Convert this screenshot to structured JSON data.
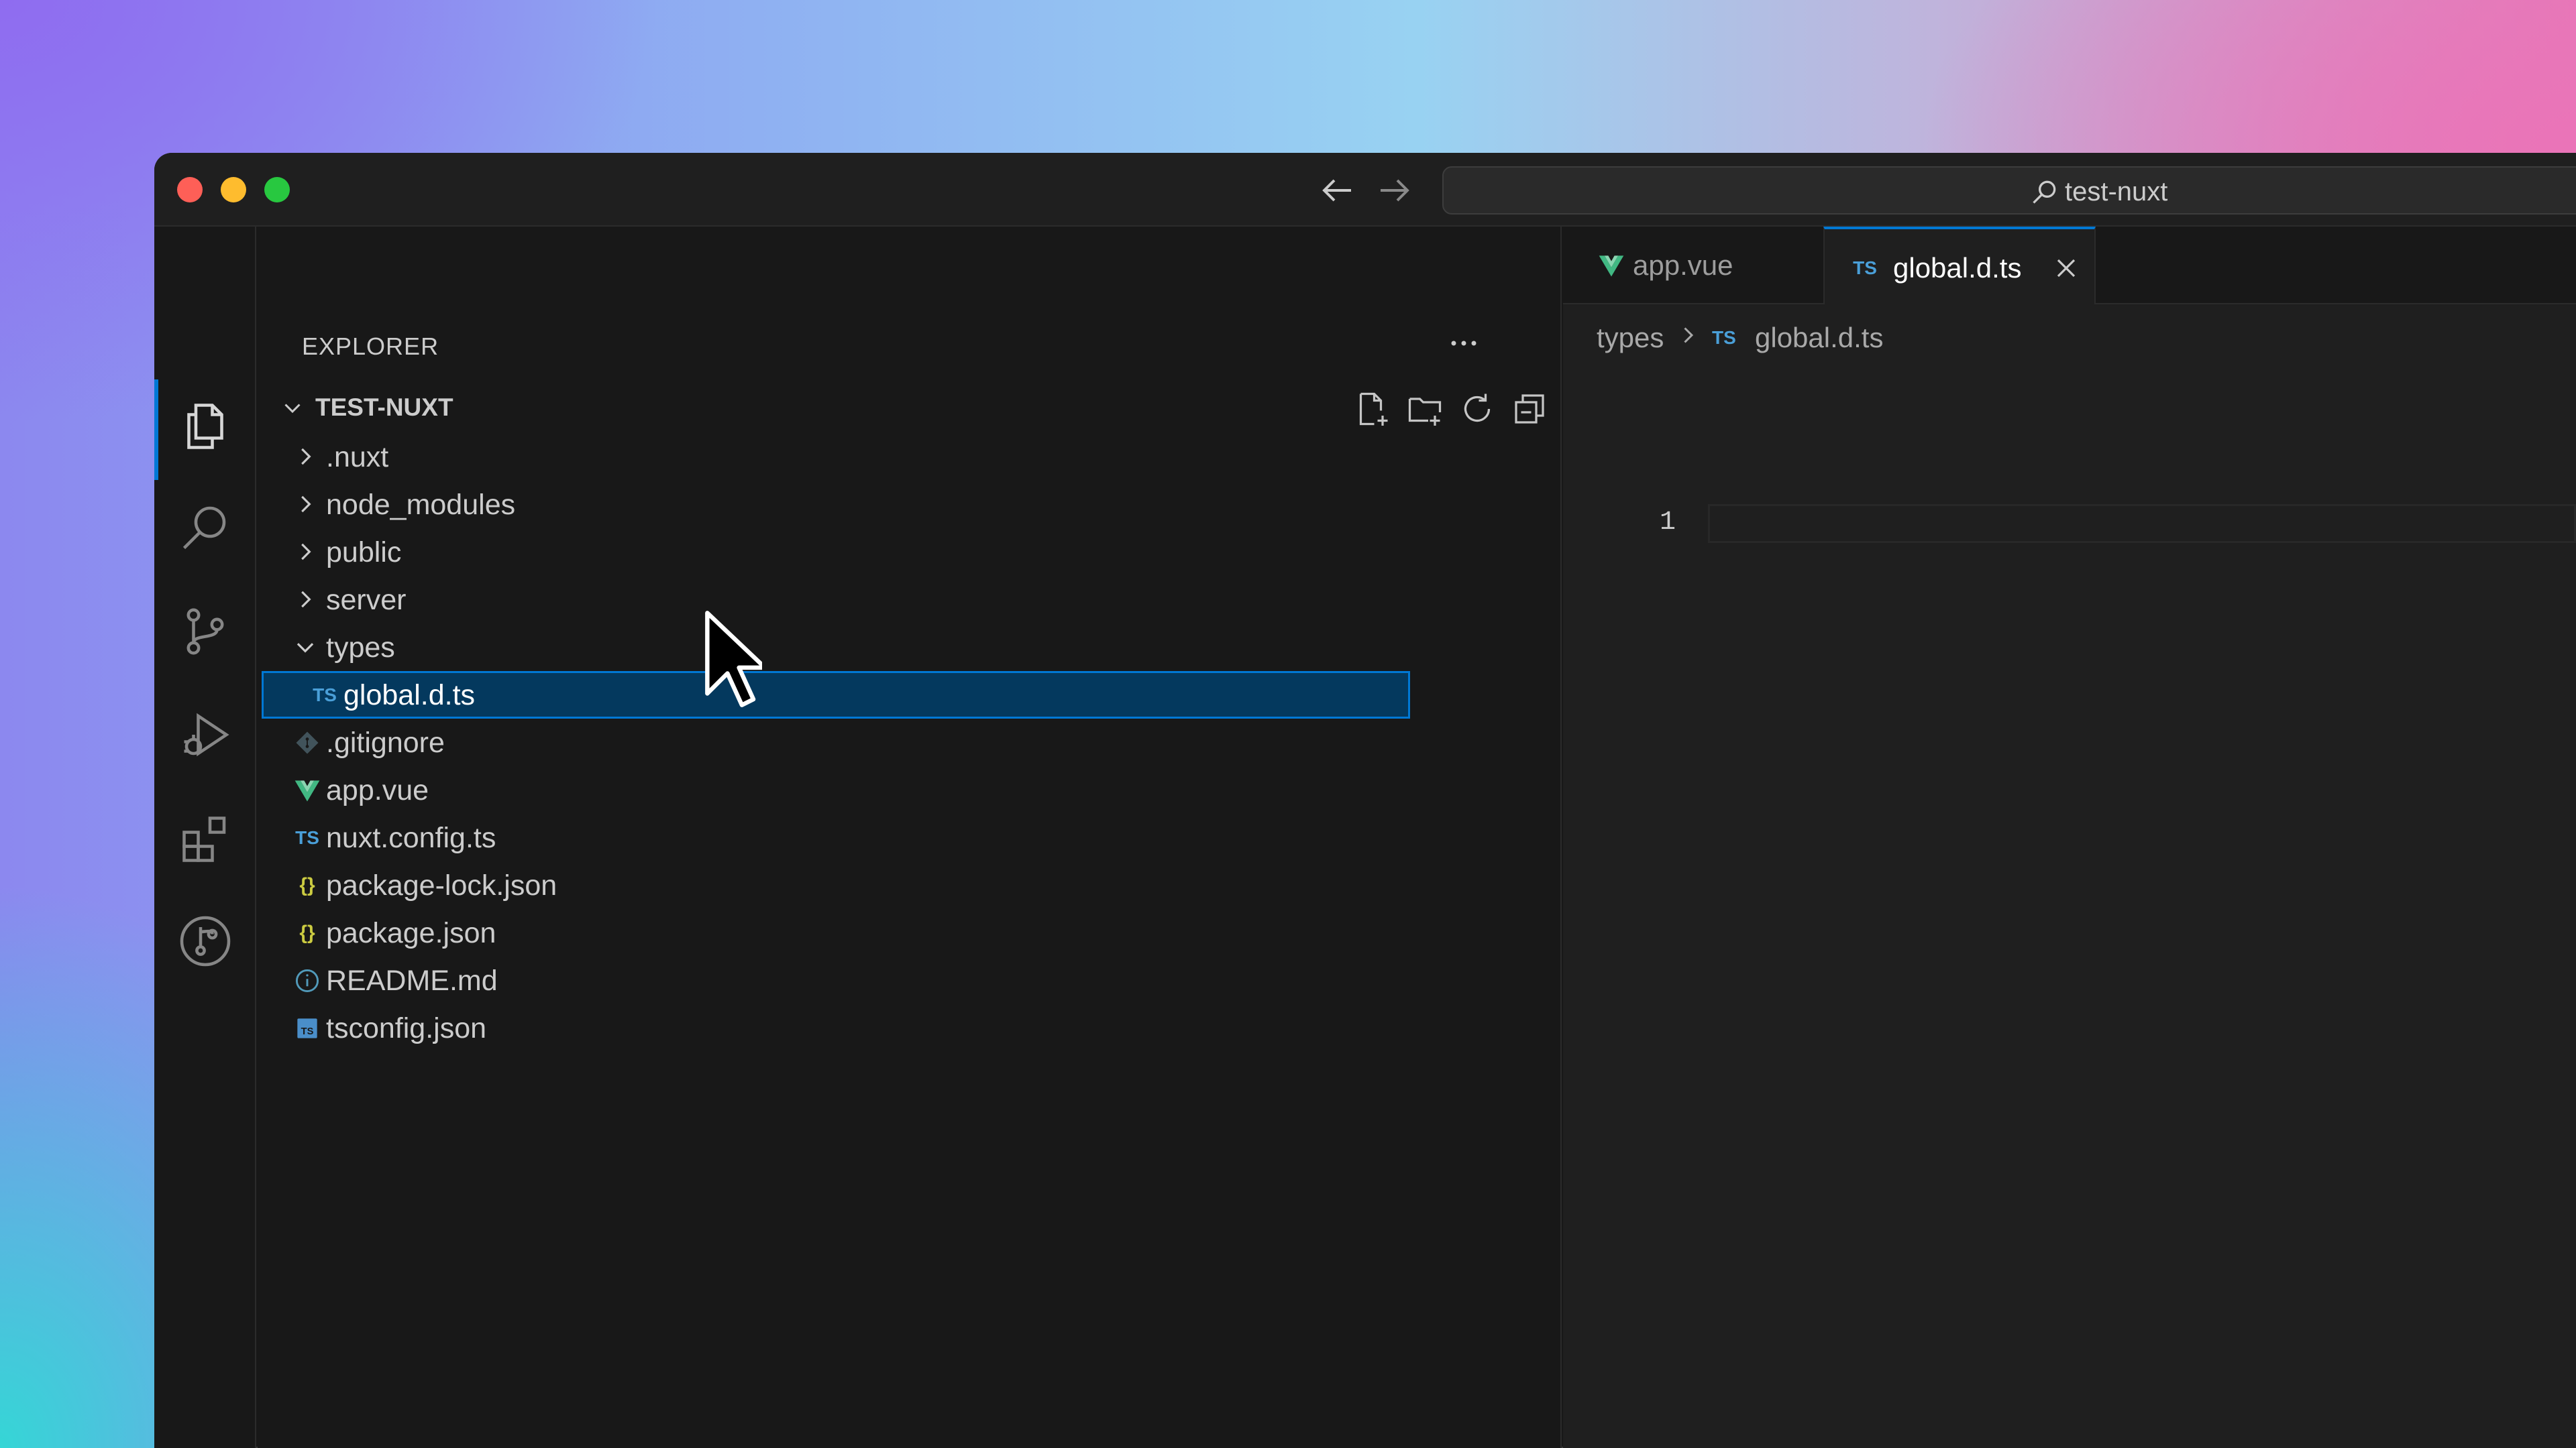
{
  "titlebar": {
    "search_text": "test-nuxt"
  },
  "explorer": {
    "title": "EXPLORER",
    "folder_name": "TEST-NUXT",
    "items": [
      {
        "name": ".nuxt",
        "type": "folder",
        "expanded": false
      },
      {
        "name": "node_modules",
        "type": "folder",
        "expanded": false
      },
      {
        "name": "public",
        "type": "folder",
        "expanded": false
      },
      {
        "name": "server",
        "type": "folder",
        "expanded": false
      },
      {
        "name": "types",
        "type": "folder",
        "expanded": true
      },
      {
        "name": "global.d.ts",
        "type": "ts",
        "icon_text": "TS",
        "selected": true
      },
      {
        "name": ".gitignore",
        "type": "git"
      },
      {
        "name": "app.vue",
        "type": "vue"
      },
      {
        "name": "nuxt.config.ts",
        "type": "ts",
        "icon_text": "TS"
      },
      {
        "name": "package-lock.json",
        "type": "json",
        "icon_text": "{}"
      },
      {
        "name": "package.json",
        "type": "json",
        "icon_text": "{}"
      },
      {
        "name": "README.md",
        "type": "info"
      },
      {
        "name": "tsconfig.json",
        "type": "tsconfig",
        "icon_text": "TS"
      }
    ]
  },
  "tabs": [
    {
      "label": "app.vue",
      "active": false
    },
    {
      "label": "global.d.ts",
      "icon_text": "TS",
      "active": true
    }
  ],
  "breadcrumbs": {
    "folder": "types",
    "file_icon_text": "TS",
    "file": "global.d.ts"
  },
  "editor": {
    "line_number": "1"
  },
  "colors": {
    "accent": "#0078d4",
    "selection_bg": "#04395e",
    "ts_blue": "#4a9fd8",
    "vue_green": "#41b883",
    "json_yellow": "#cbcb41"
  }
}
